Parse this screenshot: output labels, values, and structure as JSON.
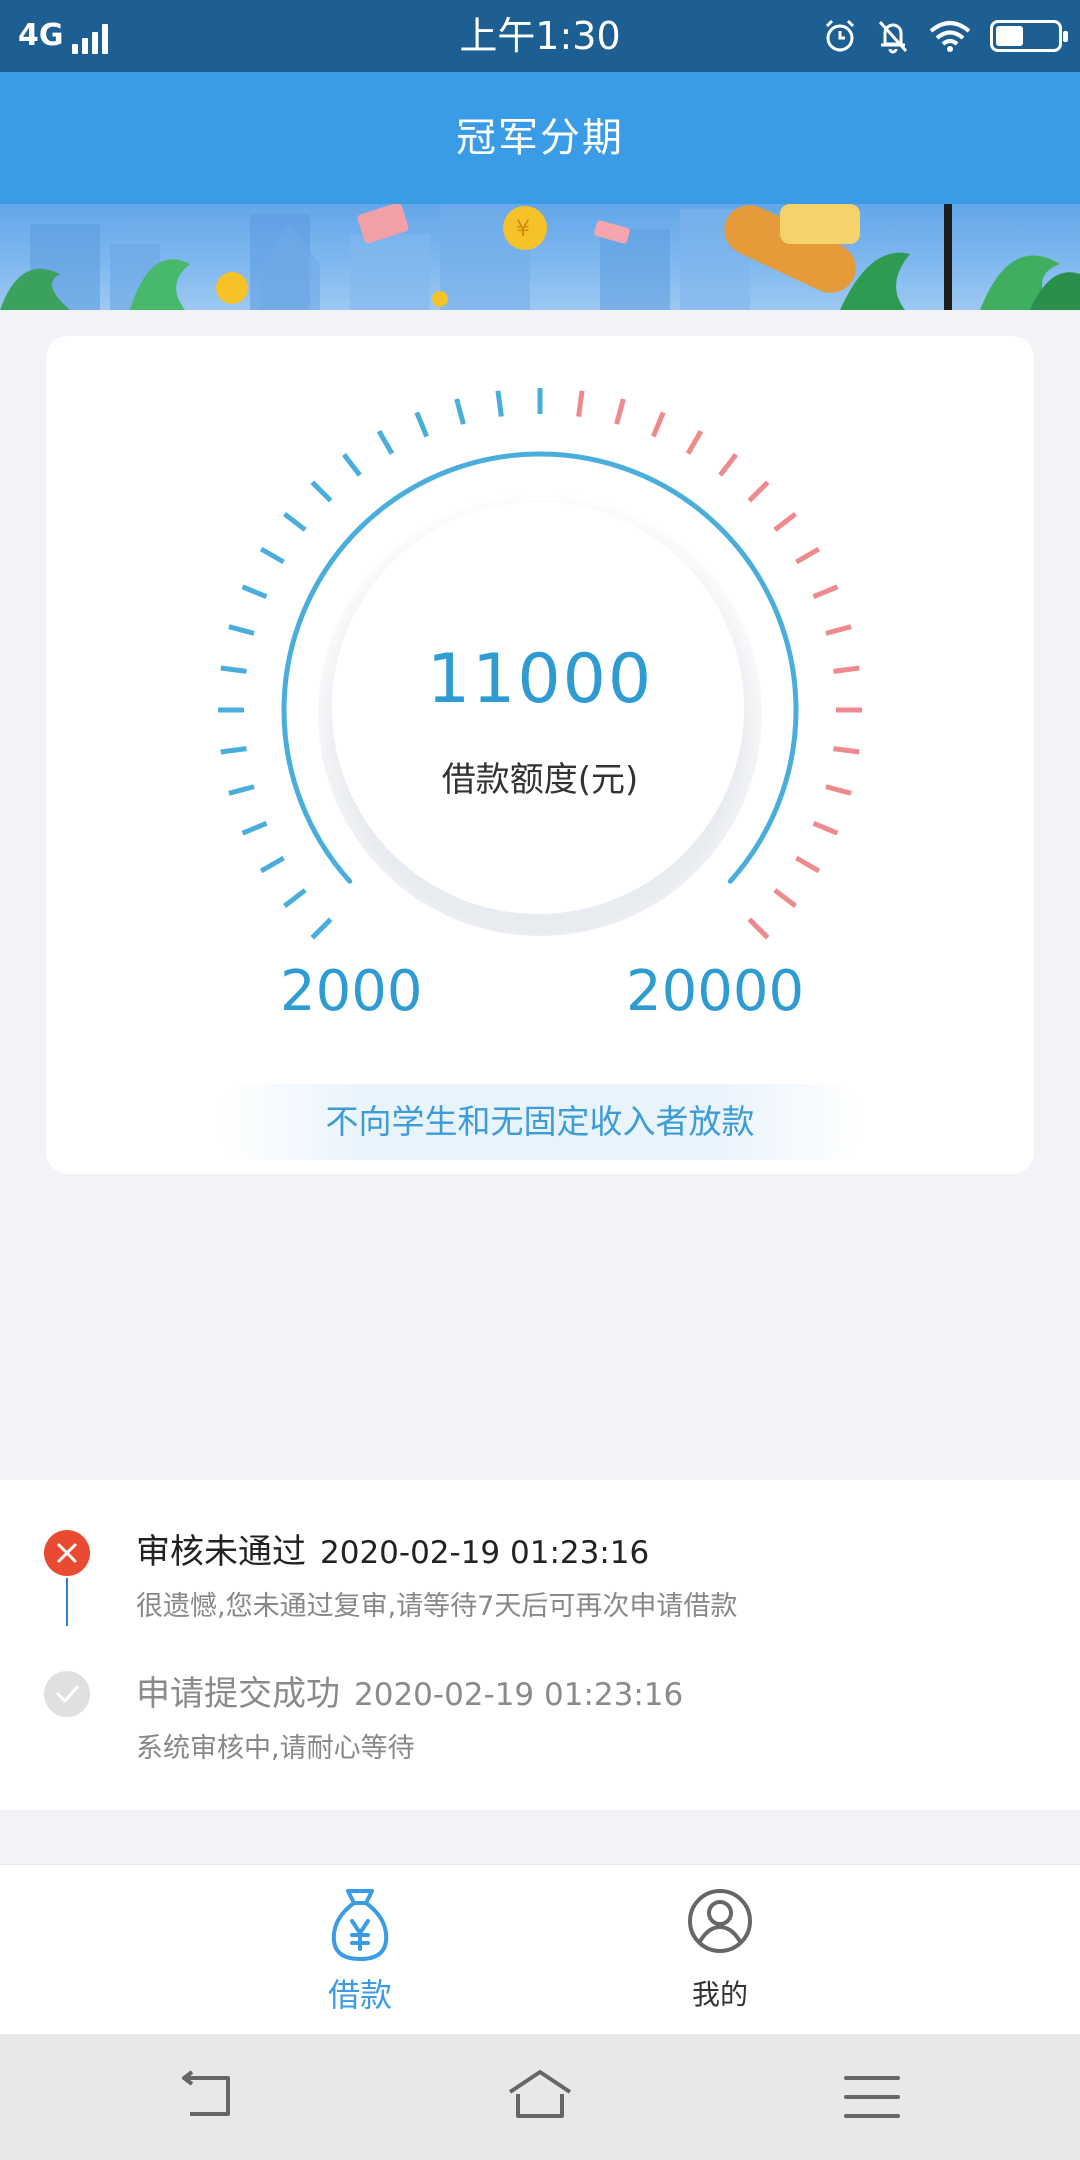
{
  "status_bar": {
    "network": "4G",
    "time": "上午1:30",
    "icons": [
      "alarm-icon",
      "bell-off-icon",
      "wifi-icon",
      "battery-icon"
    ],
    "battery_level": 0.45
  },
  "header": {
    "title": "冠军分期"
  },
  "gauge": {
    "value": "11000",
    "label": "借款额度(元)",
    "min": "2000",
    "max": "20000",
    "colors": {
      "blue": "#4aaedc",
      "red": "#ee8a8e"
    }
  },
  "notice": "不向学生和无固定收入者放款",
  "timeline": [
    {
      "title": "审核未通过",
      "time": "2020-02-19 01:23:16",
      "desc": "很遗憾,您未通过复审,请等待7天后可再次申请借款",
      "status": "failed",
      "icon": "close-icon"
    },
    {
      "title": "申请提交成功",
      "time": "2020-02-19 01:23:16",
      "desc": "系统审核中,请耐心等待",
      "status": "done",
      "icon": "check-icon"
    }
  ],
  "tab_bar": {
    "tabs": [
      {
        "label": "借款",
        "icon": "money-bag-icon",
        "active": true
      },
      {
        "label": "我的",
        "icon": "user-icon",
        "active": false
      }
    ],
    "active_color": "#3a9be6"
  },
  "nav_bar": {
    "icons": [
      "back-icon",
      "home-icon",
      "menu-icon"
    ]
  }
}
